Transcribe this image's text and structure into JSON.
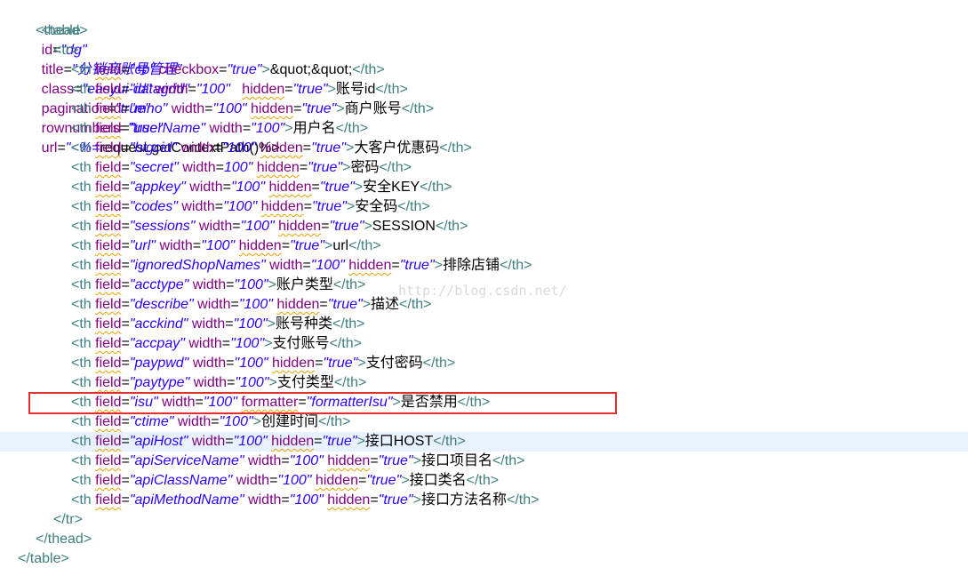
{
  "editor": {
    "watermark": "http://blog.csdn.net/",
    "line_table_open": {
      "tag_open": "<table",
      "a1": "id",
      "v1": "\"dg\"",
      "a2": "title",
      "v2": "\"分销商账号管理\"",
      "a3": "class",
      "v3": "\"easyui-datagrid\"",
      "a4": "pagination",
      "v4": "\"true\"",
      "a5": "rownumbers",
      "v5": "\"true\"",
      "a6": "url",
      "v6": "\"<%=",
      "tail": "request.getContextPath()%>"
    },
    "thead_open": "<thead>",
    "tr_open": "<tr>",
    "th_rows": [
      {
        "field": "\"cb\"",
        "rest": [
          [
            "attr",
            "checkbox"
          ],
          [
            "eq",
            "="
          ],
          [
            "val",
            "\"true\""
          ]
        ],
        "text": "&quot;&quot;"
      },
      {
        "field": "\"id\"",
        "rest": [
          [
            "attr",
            "width"
          ],
          [
            "eq",
            "="
          ],
          [
            "val",
            "\"100\"  "
          ],
          [
            "attr",
            "hidden"
          ],
          [
            "eq",
            "="
          ],
          [
            "val",
            "\"true\""
          ]
        ],
        "text": "账号id"
      },
      {
        "field": "\"mno\"",
        "rest": [
          [
            "attr",
            "width"
          ],
          [
            "eq",
            "="
          ],
          [
            "val",
            "\"100\""
          ],
          [
            "attr",
            "hidden"
          ],
          [
            "eq",
            "="
          ],
          [
            "val",
            "\"true\""
          ]
        ],
        "text": "商户账号"
      },
      {
        "field": "\"userName\"",
        "rest": [
          [
            "attr",
            "width"
          ],
          [
            "eq",
            "="
          ],
          [
            "val",
            "\"100\""
          ]
        ],
        "text": "用户名"
      },
      {
        "field": "\"bigcid\"",
        "rest": [
          [
            "attr",
            "width"
          ],
          [
            "eq",
            "="
          ],
          [
            "val",
            "\"100\""
          ],
          [
            "attr",
            "hidden"
          ],
          [
            "eq",
            "="
          ],
          [
            "val",
            "\"true\""
          ]
        ],
        "text": "大客户优惠码"
      },
      {
        "field": "\"secret\"",
        "rest": [
          [
            "attr",
            "width"
          ],
          [
            "eq",
            "="
          ],
          [
            "val",
            "100\""
          ],
          [
            "attr",
            "hidden"
          ],
          [
            "eq",
            "="
          ],
          [
            "val",
            "\"true\""
          ]
        ],
        "text": "密码"
      },
      {
        "field": "\"appkey\"",
        "rest": [
          [
            "attr",
            "width"
          ],
          [
            "eq",
            "="
          ],
          [
            "val",
            "\"100\""
          ],
          [
            "attr",
            "hidden"
          ],
          [
            "eq",
            "="
          ],
          [
            "val",
            "\"true\""
          ]
        ],
        "text": "安全KEY"
      },
      {
        "field": "\"codes\"",
        "rest": [
          [
            "attr",
            "width"
          ],
          [
            "eq",
            "="
          ],
          [
            "val",
            "\"100\""
          ],
          [
            "attr",
            "hidden"
          ],
          [
            "eq",
            "="
          ],
          [
            "val",
            "\"true\""
          ]
        ],
        "text": "安全码"
      },
      {
        "field": "\"sessions\"",
        "rest": [
          [
            "attr",
            "width"
          ],
          [
            "eq",
            "="
          ],
          [
            "val",
            "\"100\""
          ],
          [
            "attr",
            "hidden"
          ],
          [
            "eq",
            "="
          ],
          [
            "val",
            "\"true\""
          ]
        ],
        "text": "SESSION"
      },
      {
        "field": "\"url\"",
        "rest": [
          [
            "attr",
            "width"
          ],
          [
            "eq",
            "="
          ],
          [
            "val",
            "\"100\""
          ],
          [
            "attr",
            "hidden"
          ],
          [
            "eq",
            "="
          ],
          [
            "val",
            "\"true\""
          ]
        ],
        "text": "url"
      },
      {
        "field": "\"ignoredShopNames\"",
        "rest": [
          [
            "attr",
            "width"
          ],
          [
            "eq",
            "="
          ],
          [
            "val",
            "\"100\""
          ],
          [
            "attr",
            "hidden"
          ],
          [
            "eq",
            "="
          ],
          [
            "val",
            "\"true\""
          ]
        ],
        "text": "排除店铺"
      },
      {
        "field": "\"acctype\"",
        "rest": [
          [
            "attr",
            "width"
          ],
          [
            "eq",
            "="
          ],
          [
            "val",
            "\"100\""
          ]
        ],
        "text": "账户类型"
      },
      {
        "field": "\"describe\"",
        "rest": [
          [
            "attr",
            "width"
          ],
          [
            "eq",
            "="
          ],
          [
            "val",
            "\"100\""
          ],
          [
            "attr",
            "hidden"
          ],
          [
            "eq",
            "="
          ],
          [
            "val",
            "\"true\""
          ]
        ],
        "text": "描述"
      },
      {
        "field": "\"acckind\"",
        "rest": [
          [
            "attr",
            "width"
          ],
          [
            "eq",
            "="
          ],
          [
            "val",
            "\"100\""
          ]
        ],
        "text": "账号种类"
      },
      {
        "field": "\"accpay\"",
        "rest": [
          [
            "attr",
            "width"
          ],
          [
            "eq",
            "="
          ],
          [
            "val",
            "\"100\""
          ]
        ],
        "text": "支付账号"
      },
      {
        "field": "\"paypwd\"",
        "rest": [
          [
            "attr",
            "width"
          ],
          [
            "eq",
            "="
          ],
          [
            "val",
            "\"100\""
          ],
          [
            "attr",
            "hidden"
          ],
          [
            "eq",
            "="
          ],
          [
            "val",
            "\"true\""
          ]
        ],
        "text": "支付密码"
      },
      {
        "field": "\"paytype\"",
        "rest": [
          [
            "attr",
            "width"
          ],
          [
            "eq",
            "="
          ],
          [
            "val",
            "\"100\""
          ]
        ],
        "text": "支付类型"
      },
      {
        "field": "\"isu\"",
        "rest": [
          [
            "attr",
            "width"
          ],
          [
            "eq",
            "="
          ],
          [
            "val",
            "\"100\""
          ],
          [
            "attr",
            "formatter"
          ],
          [
            "eq",
            "="
          ],
          [
            "val",
            "\"formatterIsu\""
          ]
        ],
        "text": "是否禁用"
      },
      {
        "field": "\"ctime\"",
        "rest": [
          [
            "attr",
            "width"
          ],
          [
            "eq",
            "="
          ],
          [
            "val",
            "\"100\""
          ]
        ],
        "text": "创建时间"
      },
      {
        "field": "\"apiHost\"",
        "rest": [
          [
            "attr",
            "width"
          ],
          [
            "eq",
            "="
          ],
          [
            "val",
            "\"100\""
          ],
          [
            "attr",
            "hidden"
          ],
          [
            "eq",
            "="
          ],
          [
            "val",
            "\"true\""
          ]
        ],
        "text": "接口HOST"
      },
      {
        "field": "\"apiServiceName\"",
        "rest": [
          [
            "attr",
            "width"
          ],
          [
            "eq",
            "="
          ],
          [
            "val",
            "\"100\""
          ],
          [
            "attr",
            "hidden"
          ],
          [
            "eq",
            "="
          ],
          [
            "val",
            "\"true\""
          ]
        ],
        "text": "接口项目名"
      },
      {
        "field": "\"apiClassName\"",
        "rest": [
          [
            "attr",
            "width"
          ],
          [
            "eq",
            "="
          ],
          [
            "val",
            "\"100\""
          ],
          [
            "attr",
            "hidden"
          ],
          [
            "eq",
            "="
          ],
          [
            "val",
            "\"true\""
          ]
        ],
        "text": "接口类名"
      },
      {
        "field": "\"apiMethodName\"",
        "rest": [
          [
            "attr",
            "width"
          ],
          [
            "eq",
            "="
          ],
          [
            "val",
            "\"100\""
          ],
          [
            "attr",
            "hidden"
          ],
          [
            "eq",
            "="
          ],
          [
            "val",
            "\"true\""
          ]
        ],
        "text": "接口方法名称"
      }
    ],
    "th_open": "<th",
    "th_field_attr": "field",
    "th_close_bracket": ">",
    "th_close": "</th>",
    "tr_close": "</tr>",
    "thead_close": "</thead>",
    "table_close": "</table>",
    "highlighted_row_index": 18,
    "current_line_row_index": 19
  }
}
